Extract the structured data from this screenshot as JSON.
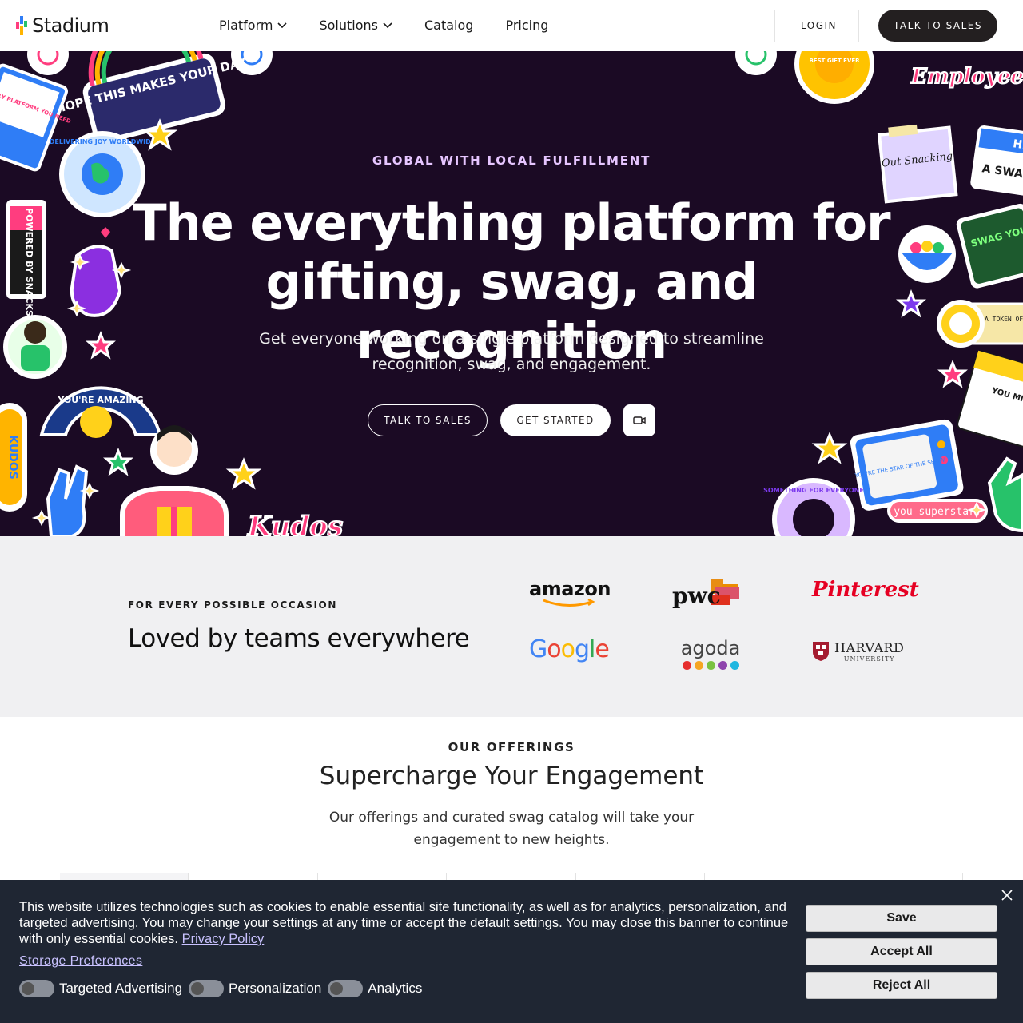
{
  "nav": {
    "logo": "Stadium",
    "links": [
      {
        "label": "Platform",
        "has_dropdown": true
      },
      {
        "label": "Solutions",
        "has_dropdown": true
      },
      {
        "label": "Catalog",
        "has_dropdown": false
      },
      {
        "label": "Pricing",
        "has_dropdown": false
      }
    ],
    "login": "LOGIN",
    "talk_to_sales": "TALK TO SALES"
  },
  "hero": {
    "eyebrow": "GLOBAL WITH LOCAL FULFILLMENT",
    "title": "The everything platform for gifting, swag, and recognition",
    "subtitle": "Get everyone working on a single platform designed to streamline recognition, swag, and engagement.",
    "cta_outline": "TALK TO SALES",
    "cta_primary": "GET STARTED",
    "video_icon": "video-camera-icon",
    "stickers": {
      "hope": "HOPE THIS MAKES YOUR DAY",
      "laptop": "THE ONLY PLATFORM YOU NEED",
      "globe": "DELIVERING JOY WORLDWIDE",
      "battery": "POWERED BY SNACKS",
      "amazing": "YOU'RE AMAZING",
      "kudos_side": "KUDOS",
      "kudos": "Kudos",
      "best_gift": "BEST GIFT EVER",
      "empowerment": "Employee Empowerment",
      "note": "Out Snacking",
      "hello": "HELLO",
      "hello_sub": "A SWAG",
      "swag": "SWAG YOU'LL WANT TO KEEP",
      "token": "A TOKEN OF APPRECIATION",
      "love": "YOU MIGHT FALL IN LOVE WITH OUR CATALOG",
      "tv": "YOU'RE THE STAR OF THE SHOW",
      "something": "SOMETHING FOR EVERYONE",
      "superstar": "you superstar!"
    },
    "background_color": "#1b0a24",
    "eyebrow_color": "#e6c5ff"
  },
  "logos": {
    "eyebrow": "FOR EVERY POSSIBLE OCCASION",
    "title": "Loved by teams everywhere",
    "brands": {
      "amazon": "amazon",
      "pwc": "pwc",
      "pinterest": "Pinterest",
      "google": "Google",
      "agoda": "agoda",
      "harvard": "HARVARD",
      "harvard_sub": "UNIVERSITY"
    }
  },
  "offerings": {
    "eyebrow": "OUR OFFERINGS",
    "title": "Supercharge Your Engagement",
    "subtitle": "Our offerings and curated swag catalog will take your engagement to new heights."
  },
  "cookie": {
    "text": "This website utilizes technologies such as cookies to enable essential site functionality, as well as for analytics, personalization, and targeted advertising. You may change your settings at any time or accept the default settings. You may close this banner to continue with only essential cookies.",
    "privacy_link": "Privacy Policy",
    "storage_link": "Storage Preferences",
    "toggles": [
      "Targeted Advertising",
      "Personalization",
      "Analytics"
    ],
    "save": "Save",
    "accept_all": "Accept All",
    "reject_all": "Reject All",
    "close_icon": "close-icon"
  }
}
